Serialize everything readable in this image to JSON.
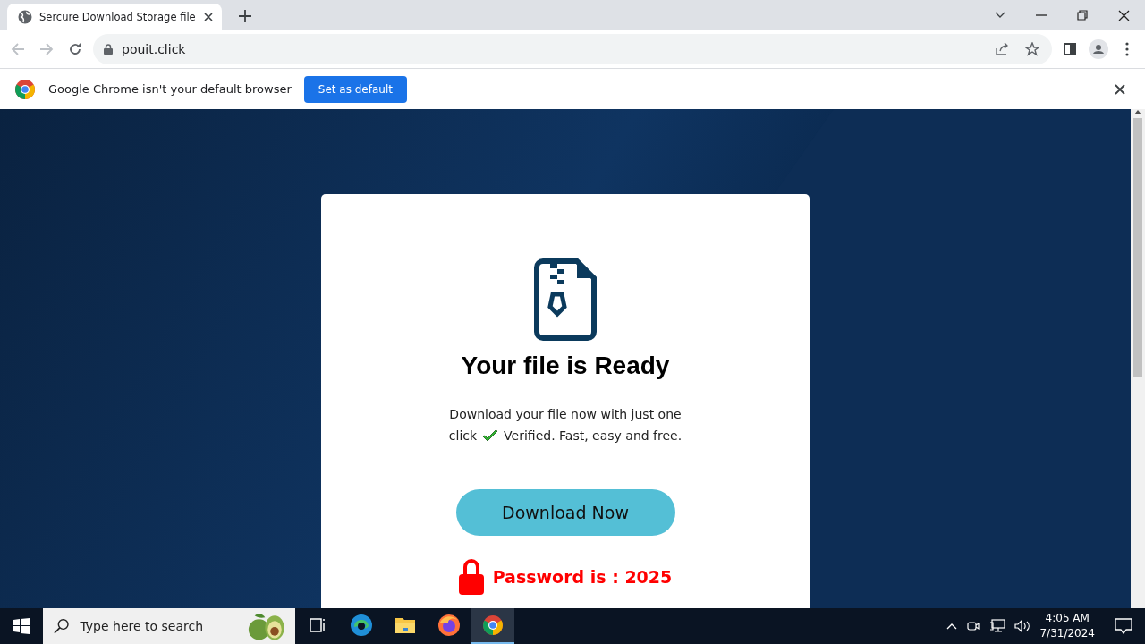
{
  "tabs": [
    {
      "title": "Sercure Download Storage file",
      "selected": true
    }
  ],
  "address_bar": {
    "url": "pouit.click"
  },
  "infobar": {
    "message": "Google Chrome isn't your default browser",
    "button": "Set as default"
  },
  "card": {
    "heading": "Your file is Ready",
    "description_line1": "Download your file now with just one",
    "description_line2_start": "click",
    "description_line2_end": "Verified. Fast, easy and free.",
    "button": "Download Now",
    "password": "Password is : 2025"
  },
  "taskbar": {
    "search_placeholder": "Type here to search",
    "apps": [
      {
        "kind": "taskview",
        "active": false
      },
      {
        "kind": "edge",
        "active": false
      },
      {
        "kind": "folder",
        "active": false
      },
      {
        "kind": "firefox",
        "active": false
      },
      {
        "kind": "chrome",
        "active": true
      }
    ],
    "time": "4:05 AM",
    "date": "7/31/2024"
  }
}
